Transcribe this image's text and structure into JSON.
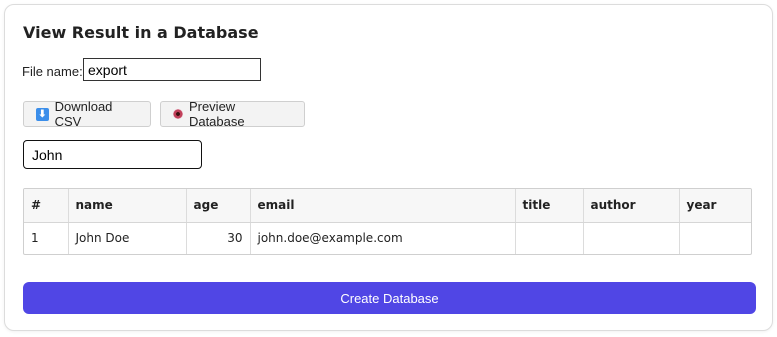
{
  "header": {
    "title": "View Result in a Database"
  },
  "file": {
    "label": "File name:",
    "value": "export"
  },
  "buttons": {
    "download_csv": {
      "label": "Download CSV",
      "icon": "download-icon"
    },
    "preview_db": {
      "label": "Preview Database",
      "icon": "eye-icon"
    }
  },
  "search": {
    "value": "John"
  },
  "table": {
    "columns": [
      "#",
      "name",
      "age",
      "email",
      "title",
      "author",
      "year"
    ],
    "rows": [
      [
        "1",
        "John Doe",
        "30",
        "john.doe@example.com",
        "",
        "",
        ""
      ]
    ]
  },
  "create": {
    "label": "Create Database"
  },
  "colors": {
    "accent": "#5046e5",
    "download_icon": "#3b8eea"
  }
}
